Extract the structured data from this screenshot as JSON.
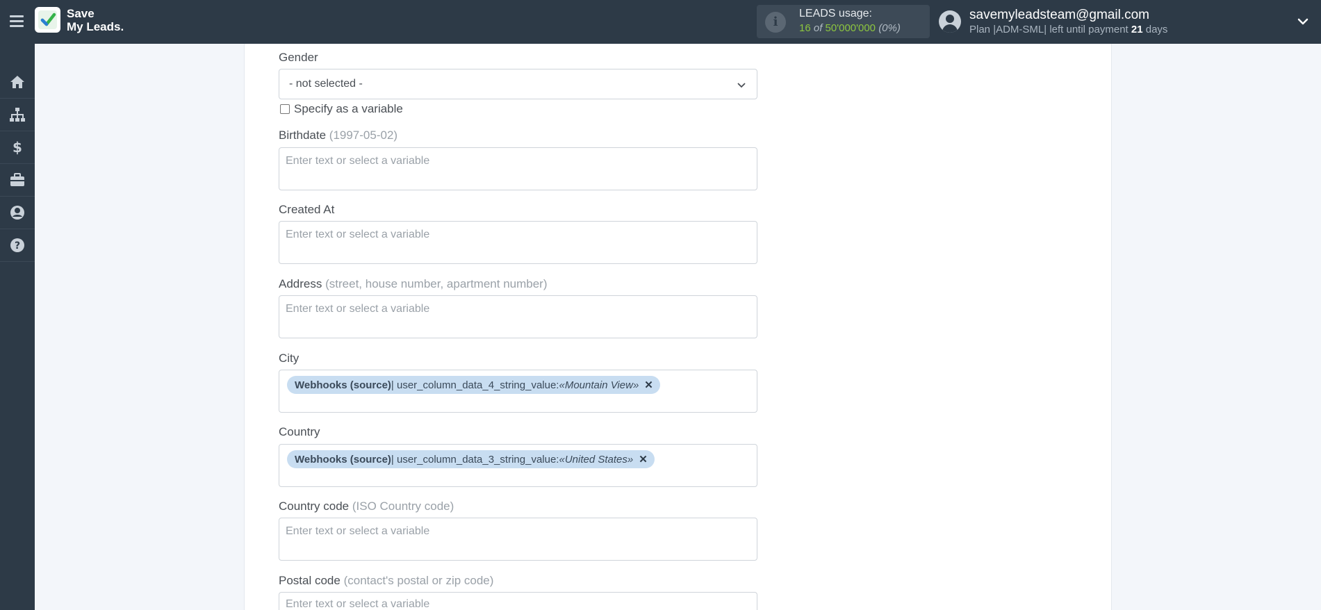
{
  "header": {
    "logo_line1": "Save",
    "logo_line2": "My Leads.",
    "usage_title": "LEADS usage:",
    "usage_used": "16",
    "usage_of": "of",
    "usage_total": "50'000'000",
    "usage_percent": "(0%)",
    "email": "savemyleadsteam@gmail.com",
    "plan_prefix": "Plan |ADM-SML| left until payment",
    "plan_days": "21",
    "plan_suffix": "days"
  },
  "sidebar": {
    "items": [
      {
        "icon": "home-icon"
      },
      {
        "icon": "sitemap-icon"
      },
      {
        "icon": "dollar-icon"
      },
      {
        "icon": "briefcase-icon"
      },
      {
        "icon": "user-icon"
      },
      {
        "icon": "help-icon"
      }
    ]
  },
  "form": {
    "gender": {
      "label": "Gender",
      "value": "- not selected -"
    },
    "specify_variable": "Specify as a variable",
    "birthdate": {
      "label": "Birthdate",
      "hint": "(1997-05-02)",
      "placeholder": "Enter text or select a variable"
    },
    "created_at": {
      "label": "Created At",
      "placeholder": "Enter text or select a variable"
    },
    "address": {
      "label": "Address",
      "hint": "(street, house number, apartment number)",
      "placeholder": "Enter text or select a variable"
    },
    "city": {
      "label": "City",
      "tag_source": "Webhooks (source)",
      "tag_field": " | user_column_data_4_string_value: ",
      "tag_value": "«Mountain View»"
    },
    "country": {
      "label": "Country",
      "tag_source": "Webhooks (source)",
      "tag_field": " | user_column_data_3_string_value: ",
      "tag_value": "«United States»"
    },
    "country_code": {
      "label": "Country code",
      "hint": "(ISO Country code)",
      "placeholder": "Enter text or select a variable"
    },
    "postal_code": {
      "label": "Postal code",
      "hint": "(contact's postal or zip code)",
      "placeholder": "Enter text or select a variable"
    }
  },
  "colors": {
    "topbar": "#2d3a47",
    "accent_green": "#8dc63f",
    "tag_bg": "#c8ddf1"
  }
}
